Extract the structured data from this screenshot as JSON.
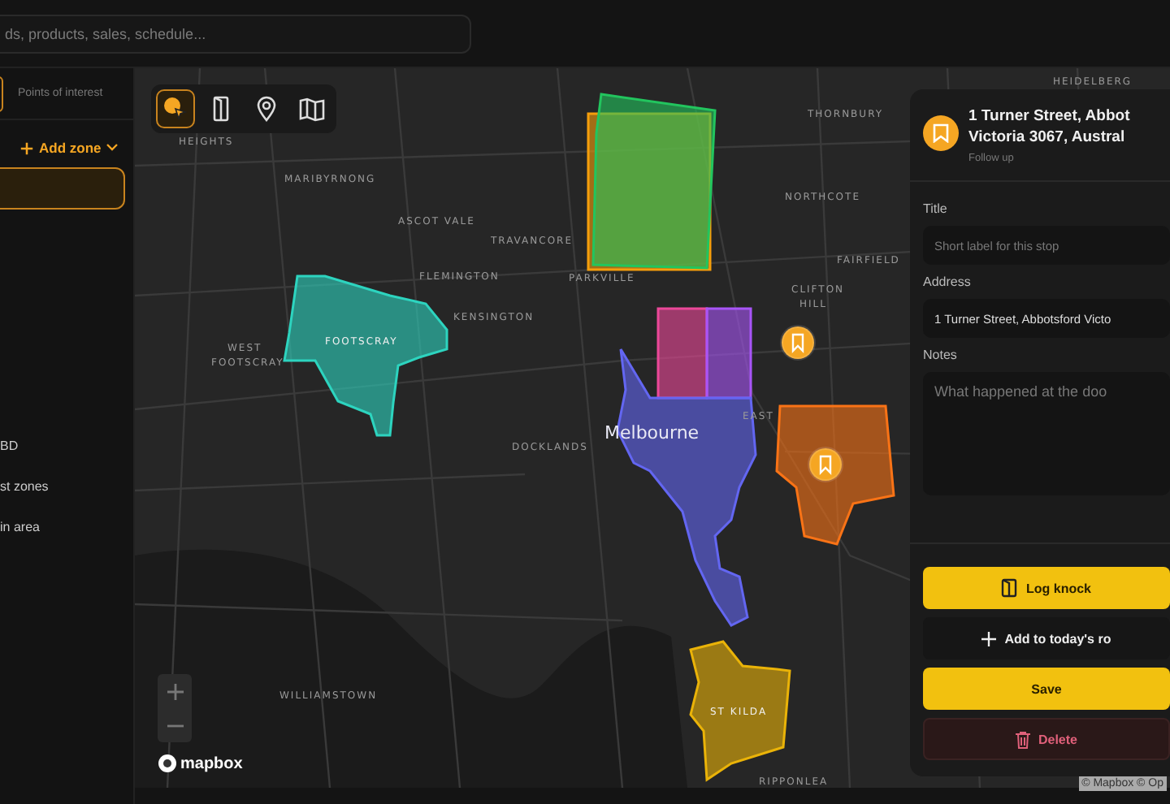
{
  "search": {
    "placeholder": "ds, products, sales, schedule..."
  },
  "sidebar": {
    "tabs": [
      {
        "selected": true
      },
      {
        "label": "Points of interest",
        "selected": false
      }
    ],
    "add_zone": "Add zone",
    "zones": [
      {
        "selected": true
      },
      {
        "label": "BD",
        "selected": false
      },
      {
        "label": "st zones",
        "selected": false
      },
      {
        "label": "in area",
        "selected": false
      }
    ]
  },
  "map": {
    "tools": [
      {
        "kind": "draw",
        "selected": true
      },
      {
        "kind": "door",
        "selected": false
      },
      {
        "kind": "pin",
        "selected": false
      },
      {
        "kind": "map",
        "selected": false
      }
    ],
    "labels": [
      {
        "text": "HEIGHTS",
        "kind": "suburb"
      },
      {
        "text": "MARIBYRNONG",
        "kind": "suburb"
      },
      {
        "text": "ASCOT VALE",
        "kind": "suburb"
      },
      {
        "text": "TRAVANCORE",
        "kind": "suburb"
      },
      {
        "text": "FLEMINGTON",
        "kind": "suburb"
      },
      {
        "text": "PARKVILLE",
        "kind": "suburb"
      },
      {
        "text": "KENSINGTON",
        "kind": "suburb"
      },
      {
        "text": "FOOTSCRAY",
        "kind": "suburb"
      },
      {
        "text": "WEST",
        "kind": "suburb"
      },
      {
        "text": "FOOTSCRAY",
        "kind": "suburb"
      },
      {
        "text": "Melbourne",
        "kind": "city"
      },
      {
        "text": "DOCKLANDS",
        "kind": "suburb"
      },
      {
        "text": "WILLIAMSTOWN",
        "kind": "suburb"
      },
      {
        "text": "ST KILDA",
        "kind": "suburb"
      },
      {
        "text": "RIPPONLEA",
        "kind": "suburb"
      },
      {
        "text": "THORNBURY",
        "kind": "suburb"
      },
      {
        "text": "NORTHCOTE",
        "kind": "suburb"
      },
      {
        "text": "FAIRFIELD",
        "kind": "suburb"
      },
      {
        "text": "CLIFTON",
        "kind": "suburb"
      },
      {
        "text": "HILL",
        "kind": "suburb"
      },
      {
        "text": "EAST",
        "kind": "suburb"
      },
      {
        "text": "HEIDELBERG",
        "kind": "suburb"
      }
    ],
    "zones": [
      {
        "color": "#f59e0b"
      },
      {
        "color": "#22c55e"
      },
      {
        "color": "#2dd4bf"
      },
      {
        "color": "#ec4899"
      },
      {
        "color": "#a855f7"
      },
      {
        "color": "#6366f1"
      },
      {
        "color": "#f97316"
      },
      {
        "color": "#eab308"
      }
    ],
    "logo": "mapbox",
    "attribution": "© Mapbox © Op"
  },
  "panel": {
    "title_lines": [
      "1 Turner Street, Abbot",
      "Victoria 3067, Austral"
    ],
    "status": "Follow up",
    "fields": [
      {
        "label": "Title",
        "kind": "input",
        "placeholder": "Short label for this stop"
      },
      {
        "label": "Address",
        "kind": "input",
        "value": "1 Turner Street, Abbotsford Victo"
      },
      {
        "label": "Notes",
        "kind": "textarea",
        "placeholder": "What happened at the doo"
      }
    ],
    "buttons": [
      {
        "label": "Log knock",
        "kind": "knock"
      },
      {
        "label": "Add to today's ro",
        "kind": "add"
      },
      {
        "label": "Save",
        "kind": "save"
      },
      {
        "label": "Delete",
        "kind": "delete"
      }
    ]
  }
}
